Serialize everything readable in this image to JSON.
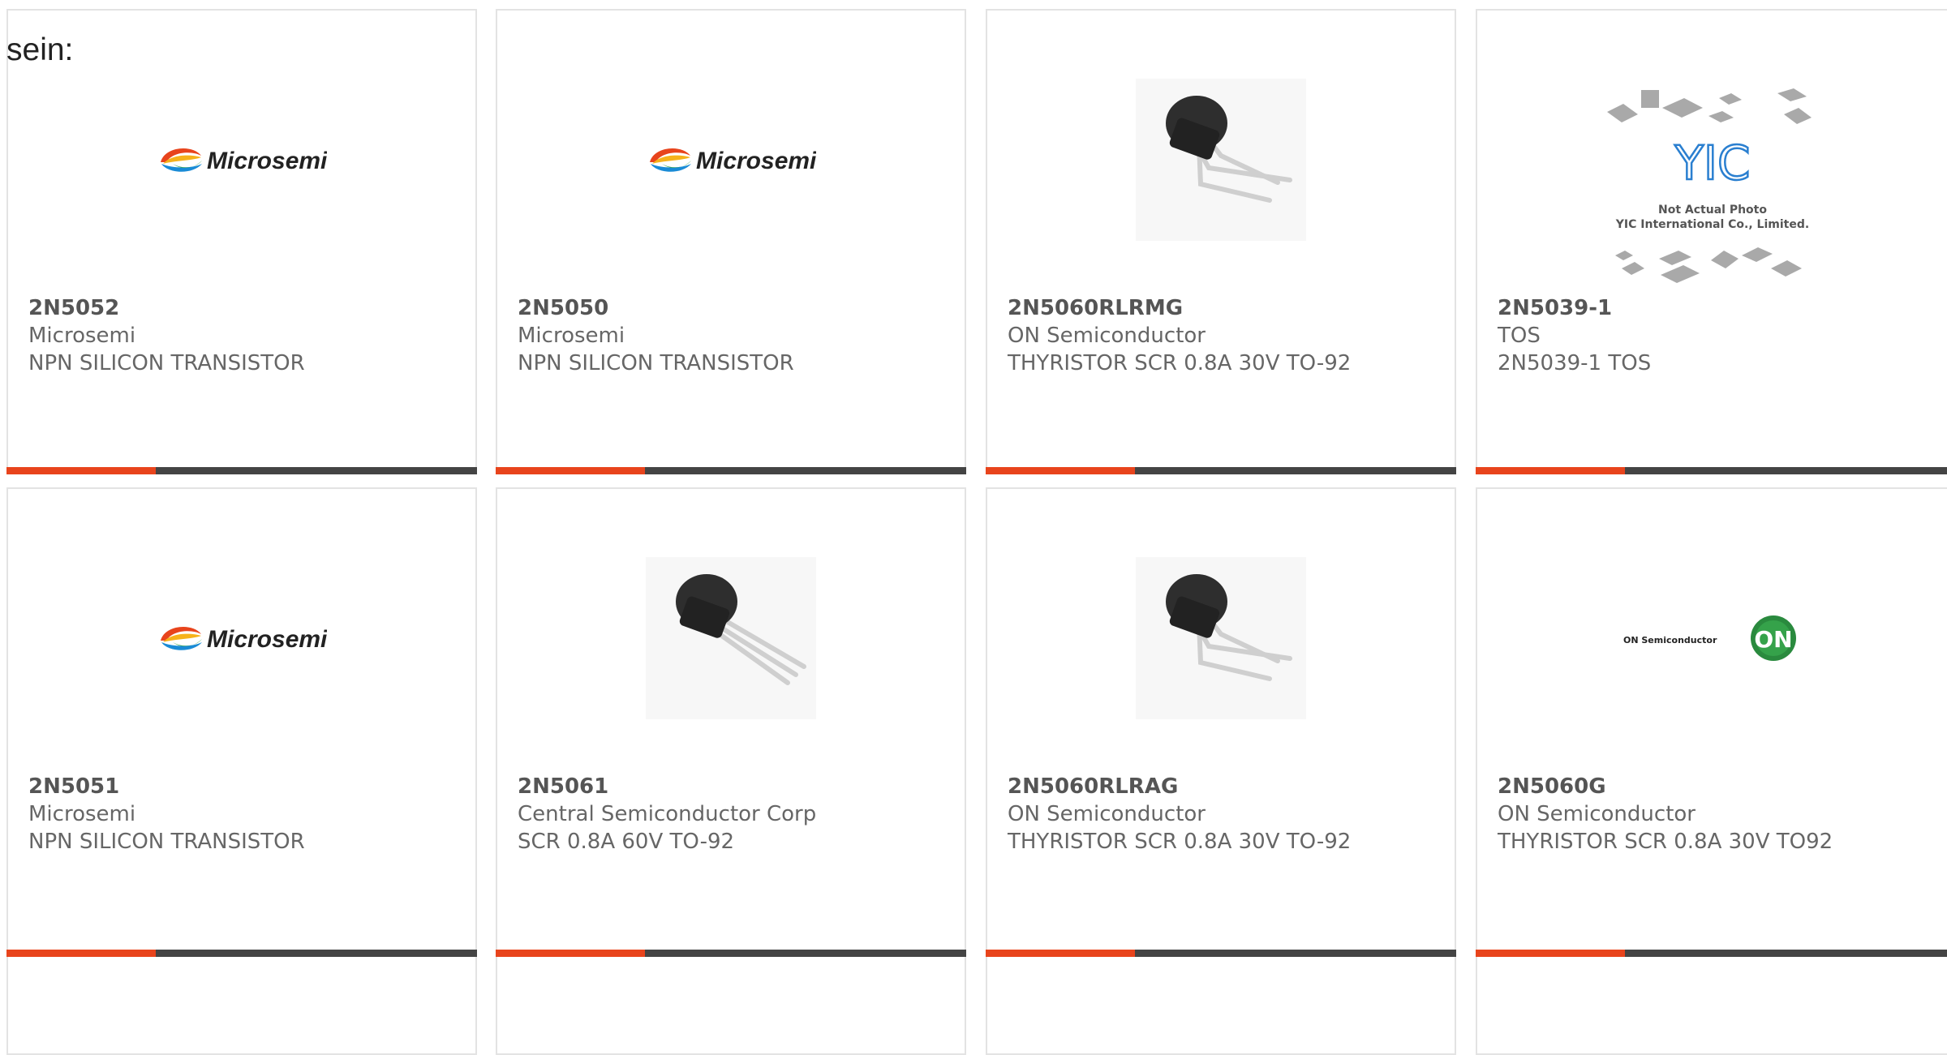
{
  "intro_text": "sein:",
  "colors": {
    "accent": "#e8441c",
    "bar": "#444444"
  },
  "products": [
    {
      "part": "2N5052",
      "manufacturer": "Microsemi",
      "description": "NPN SILICON TRANSISTOR",
      "image": "microsemi-logo"
    },
    {
      "part": "2N5050",
      "manufacturer": "Microsemi",
      "description": "NPN SILICON TRANSISTOR",
      "image": "microsemi-logo"
    },
    {
      "part": "2N5060RLRMG",
      "manufacturer": "ON Semiconductor",
      "description": "THYRISTOR SCR 0.8A 30V TO-92",
      "image": "to92-bent"
    },
    {
      "part": "2N5039-1",
      "manufacturer": "TOS",
      "description": "2N5039-1 TOS",
      "image": "yic-placeholder",
      "image_caption_1": "Not Actual Photo",
      "image_caption_2": "YIC International Co., Limited."
    },
    {
      "part": "2N5051",
      "manufacturer": "Microsemi",
      "description": "NPN SILICON TRANSISTOR",
      "image": "microsemi-logo"
    },
    {
      "part": "2N5061",
      "manufacturer": "Central Semiconductor Corp",
      "description": "SCR 0.8A 60V TO-92",
      "image": "to92-straight"
    },
    {
      "part": "2N5060RLRAG",
      "manufacturer": "ON Semiconductor",
      "description": "THYRISTOR SCR 0.8A 30V TO-92",
      "image": "to92-bent"
    },
    {
      "part": "2N5060G",
      "manufacturer": "ON Semiconductor",
      "description": "THYRISTOR SCR 0.8A 30V TO92",
      "image": "on-semi-logo",
      "logo_text": "ON Semiconductor",
      "logo_mark": "ON"
    }
  ]
}
